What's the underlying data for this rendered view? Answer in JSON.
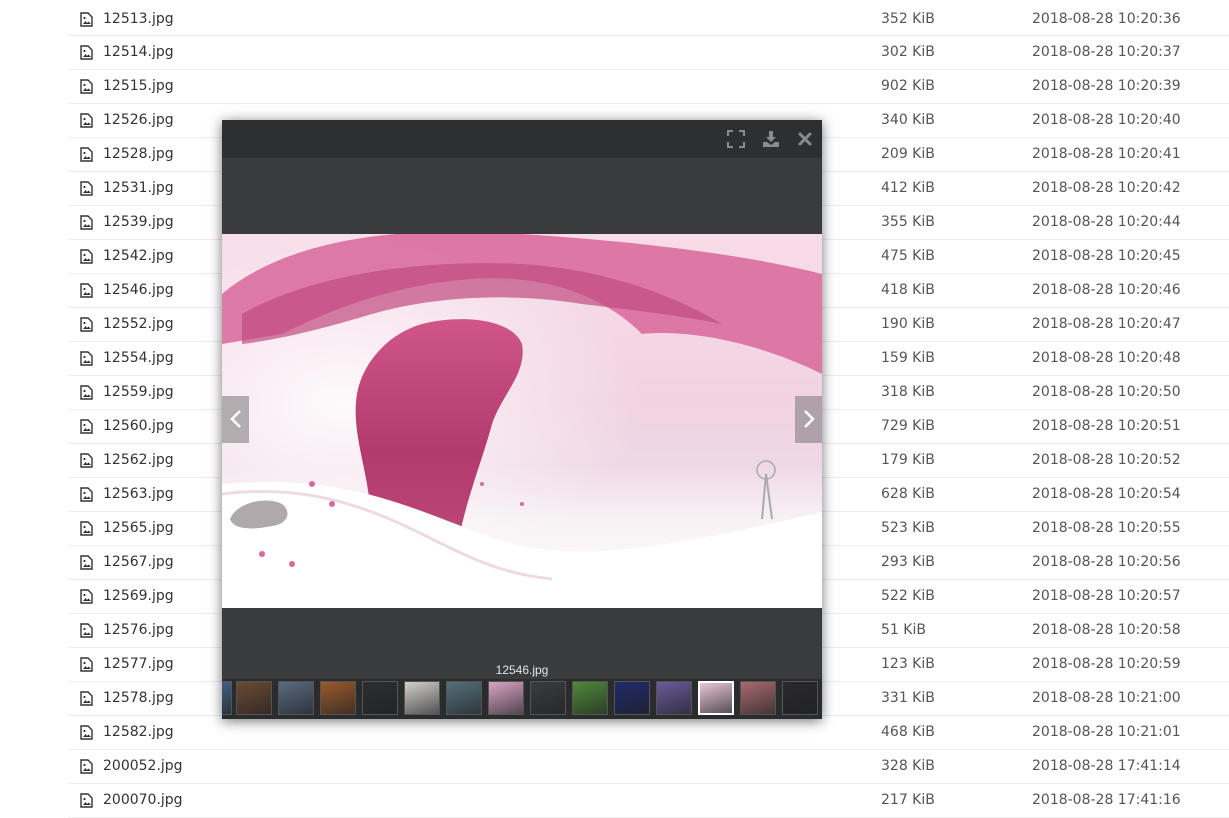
{
  "files": [
    {
      "name": "12513.jpg",
      "size": "352 KiB",
      "date": "2018-08-28 10:20:36"
    },
    {
      "name": "12514.jpg",
      "size": "302 KiB",
      "date": "2018-08-28 10:20:37"
    },
    {
      "name": "12515.jpg",
      "size": "902 KiB",
      "date": "2018-08-28 10:20:39"
    },
    {
      "name": "12526.jpg",
      "size": "340 KiB",
      "date": "2018-08-28 10:20:40"
    },
    {
      "name": "12528.jpg",
      "size": "209 KiB",
      "date": "2018-08-28 10:20:41"
    },
    {
      "name": "12531.jpg",
      "size": "412 KiB",
      "date": "2018-08-28 10:20:42"
    },
    {
      "name": "12539.jpg",
      "size": "355 KiB",
      "date": "2018-08-28 10:20:44"
    },
    {
      "name": "12542.jpg",
      "size": "475 KiB",
      "date": "2018-08-28 10:20:45"
    },
    {
      "name": "12546.jpg",
      "size": "418 KiB",
      "date": "2018-08-28 10:20:46"
    },
    {
      "name": "12552.jpg",
      "size": "190 KiB",
      "date": "2018-08-28 10:20:47"
    },
    {
      "name": "12554.jpg",
      "size": "159 KiB",
      "date": "2018-08-28 10:20:48"
    },
    {
      "name": "12559.jpg",
      "size": "318 KiB",
      "date": "2018-08-28 10:20:50"
    },
    {
      "name": "12560.jpg",
      "size": "729 KiB",
      "date": "2018-08-28 10:20:51"
    },
    {
      "name": "12562.jpg",
      "size": "179 KiB",
      "date": "2018-08-28 10:20:52"
    },
    {
      "name": "12563.jpg",
      "size": "628 KiB",
      "date": "2018-08-28 10:20:54"
    },
    {
      "name": "12565.jpg",
      "size": "523 KiB",
      "date": "2018-08-28 10:20:55"
    },
    {
      "name": "12567.jpg",
      "size": "293 KiB",
      "date": "2018-08-28 10:20:56"
    },
    {
      "name": "12569.jpg",
      "size": "522 KiB",
      "date": "2018-08-28 10:20:57"
    },
    {
      "name": "12576.jpg",
      "size": "51 KiB",
      "date": "2018-08-28 10:20:58"
    },
    {
      "name": "12577.jpg",
      "size": "123 KiB",
      "date": "2018-08-28 10:20:59"
    },
    {
      "name": "12578.jpg",
      "size": "331 KiB",
      "date": "2018-08-28 10:21:00"
    },
    {
      "name": "12582.jpg",
      "size": "468 KiB",
      "date": "2018-08-28 10:21:01"
    },
    {
      "name": "200052.jpg",
      "size": "328 KiB",
      "date": "2018-08-28 17:41:14"
    },
    {
      "name": "200070.jpg",
      "size": "217 KiB",
      "date": "2018-08-28 17:41:16"
    }
  ],
  "icons": {
    "file": "image-file-icon",
    "fullscreen": "fullscreen-icon",
    "download": "download-icon",
    "close": "close-icon",
    "prev": "chevron-left-icon",
    "next": "chevron-right-icon"
  },
  "lightbox": {
    "caption": "12546.jpg",
    "thumbnails": [
      {
        "color": "#4a6890"
      },
      {
        "color": "#6b4a32"
      },
      {
        "color": "#5a6a80"
      },
      {
        "color": "#9a5a2a"
      },
      {
        "color": "#2c2f30"
      },
      {
        "color": "#d2d0cc"
      },
      {
        "color": "#56707a"
      },
      {
        "color": "#d9a3c4"
      },
      {
        "color": "#3a3c3e"
      },
      {
        "color": "#4f8a3a"
      },
      {
        "color": "#202a6a"
      },
      {
        "color": "#6a5a9a"
      },
      {
        "color": "#e8c6d4",
        "active": true
      },
      {
        "color": "#a86a70"
      },
      {
        "color": "#2a2a2c"
      }
    ]
  },
  "colors": {
    "lightbox_bg": "#3a3b3d",
    "toolbar_bg": "#2e2f31",
    "image_pink": "#c2457a"
  }
}
